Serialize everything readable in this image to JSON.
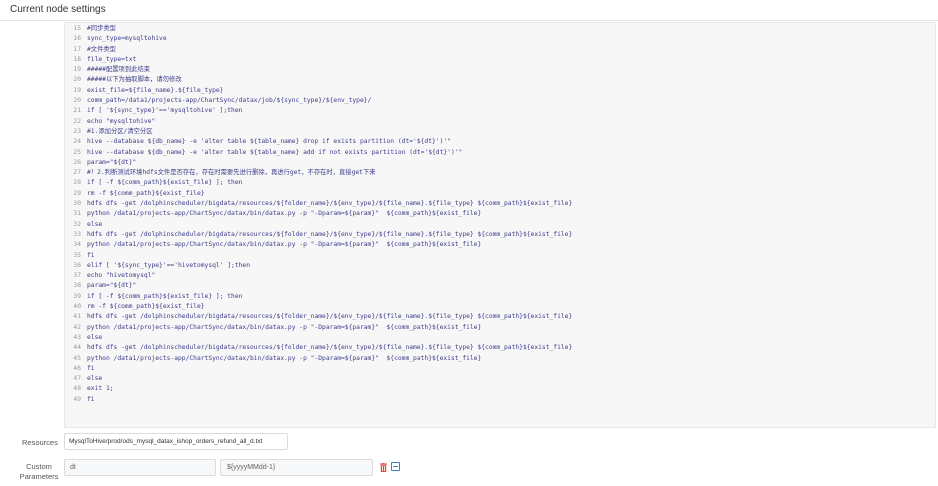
{
  "header": {
    "title": "Current node settings"
  },
  "editor": {
    "lines": [
      {
        "n": "15",
        "code": "#同步类型"
      },
      {
        "n": "16",
        "code": "sync_type=mysqltohive"
      },
      {
        "n": "17",
        "code": "#文件类型"
      },
      {
        "n": "18",
        "code": "file_type=txt"
      },
      {
        "n": "19",
        "code": "#####配置项到此结束"
      },
      {
        "n": "20",
        "code": "#####以下为抽取脚本，请勿修改"
      },
      {
        "n": "19",
        "code": "exist_file=${file_name}.${file_type}"
      },
      {
        "n": "20",
        "code": "comm_path=/data1/projects-app/ChartSync/datax/job/${sync_type}/${env_type}/"
      },
      {
        "n": "21",
        "code": "if [ '${sync_type}'=='mysqltohive' ];then"
      },
      {
        "n": "22",
        "code": "echo \"mysqltohive\""
      },
      {
        "n": "23",
        "code": "#1.添加分区/清空分区"
      },
      {
        "n": "24",
        "code": "hive --database ${db_name} -e 'alter table ${table_name} drop if exists partition (dt='${dt}')'\""
      },
      {
        "n": "25",
        "code": "hive --database ${db_name} -e 'alter table ${table_name} add if not exists partition (dt='${dt}')'\""
      },
      {
        "n": "26",
        "code": "param=\"${dt}\""
      },
      {
        "n": "27",
        "code": "#！2.判断测试环境hdfs文件是否存在，存在时需要先进行删除，再进行get，不存在时，直接get下来"
      },
      {
        "n": "28",
        "code": "if [ -f ${comm_path}${exist_file} ]; then"
      },
      {
        "n": "29",
        "code": "rm -f ${comm_path}${exist_file}"
      },
      {
        "n": "30",
        "code": "hdfs dfs -get /dolphinscheduler/bigdata/resources/${folder_name}/${env_type}/${file_name}.${file_type} ${comm_path}${exist_file}"
      },
      {
        "n": "31",
        "code": "python /data1/projects-app/ChartSync/datax/bin/datax.py -p \"-Dparam=${param}\"  ${comm_path}${exist_file}"
      },
      {
        "n": "32",
        "code": "else"
      },
      {
        "n": "33",
        "code": "hdfs dfs -get /dolphinscheduler/bigdata/resources/${folder_name}/${env_type}/${file_name}.${file_type} ${comm_path}${exist_file}"
      },
      {
        "n": "34",
        "code": "python /data1/projects-app/ChartSync/datax/bin/datax.py -p \"-Dparam=${param}\"  ${comm_path}${exist_file}"
      },
      {
        "n": "35",
        "code": "fi"
      },
      {
        "n": "36",
        "code": "elif [ '${sync_type}'=='hivetomysql' ];then"
      },
      {
        "n": "37",
        "code": "echo \"hivetomysql\""
      },
      {
        "n": "38",
        "code": "param=\"${dt}\""
      },
      {
        "n": "39",
        "code": "if [ -f ${comm_path}${exist_file} ]; then"
      },
      {
        "n": "40",
        "code": "rm -f ${comm_path}${exist_file}"
      },
      {
        "n": "41",
        "code": "hdfs dfs -get /dolphinscheduler/bigdata/resources/${folder_name}/${env_type}/${file_name}.${file_type} ${comm_path}${exist_file}"
      },
      {
        "n": "42",
        "code": "python /data1/projects-app/ChartSync/datax/bin/datax.py -p \"-Dparam=${param}\"  ${comm_path}${exist_file}"
      },
      {
        "n": "43",
        "code": "else"
      },
      {
        "n": "44",
        "code": "hdfs dfs -get /dolphinscheduler/bigdata/resources/${folder_name}/${env_type}/${file_name}.${file_type} ${comm_path}${exist_file}"
      },
      {
        "n": "45",
        "code": "python /data1/projects-app/ChartSync/datax/bin/datax.py -p \"-Dparam=${param}\"  ${comm_path}${exist_file}"
      },
      {
        "n": "46",
        "code": "fi"
      },
      {
        "n": "47",
        "code": "else"
      },
      {
        "n": "48",
        "code": "exit 1;"
      },
      {
        "n": "49",
        "code": "fi"
      }
    ]
  },
  "resources": {
    "label": "Resources",
    "value": "MysqlToHive/prod/ods_mysql_datax_ishop_orders_refund_all_d.txt"
  },
  "custom_parameters": {
    "label": "Custom Parameters",
    "key": "dt",
    "value": "${yyyyMMdd-1}"
  },
  "icons": {
    "delete": "trash-icon",
    "add": "add-box-icon"
  },
  "colors": {
    "delete": "#e24a4a",
    "add": "#3a7ed0"
  }
}
